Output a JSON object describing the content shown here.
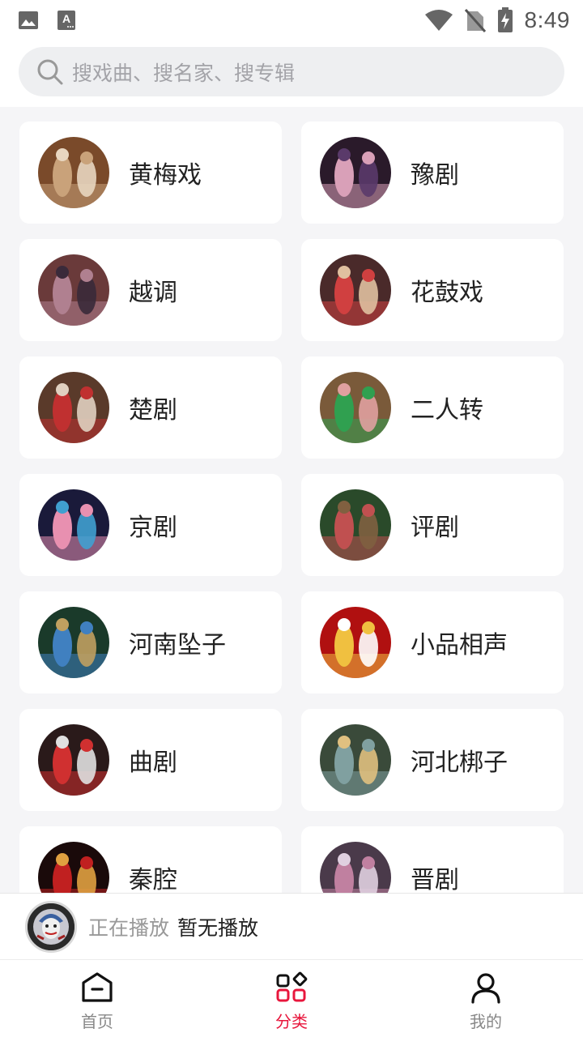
{
  "status_bar": {
    "left_icons": [
      "image-icon",
      "text-icon"
    ],
    "right_icons": [
      "wifi-icon",
      "no-sim-icon",
      "battery-charging-icon"
    ],
    "time": "8:49"
  },
  "search": {
    "placeholder": "搜戏曲、搜名家、搜专辑"
  },
  "categories": [
    {
      "label": "黄梅戏",
      "thumb_colors": [
        "#7a4a2a",
        "#c9a27a",
        "#e8d6c0"
      ]
    },
    {
      "label": "豫剧",
      "thumb_colors": [
        "#2a1a2a",
        "#d9a0b8",
        "#5a3a6a"
      ]
    },
    {
      "label": "越调",
      "thumb_colors": [
        "#6a3a3a",
        "#b08090",
        "#3a2a3a"
      ]
    },
    {
      "label": "花鼓戏",
      "thumb_colors": [
        "#4a2a2a",
        "#d04040",
        "#e0c0a0"
      ]
    },
    {
      "label": "楚剧",
      "thumb_colors": [
        "#5a3a2a",
        "#c03030",
        "#e0d0c0"
      ]
    },
    {
      "label": "二人转",
      "thumb_colors": [
        "#7a5a3a",
        "#30a050",
        "#e0a0a0"
      ]
    },
    {
      "label": "京剧",
      "thumb_colors": [
        "#1a1a3a",
        "#e890b0",
        "#40a0d0"
      ]
    },
    {
      "label": "评剧",
      "thumb_colors": [
        "#2a4a2a",
        "#c05050",
        "#806040"
      ]
    },
    {
      "label": "河南坠子",
      "thumb_colors": [
        "#1a3a2a",
        "#4080c0",
        "#c0a060"
      ]
    },
    {
      "label": "小品相声",
      "thumb_colors": [
        "#b01010",
        "#f0c040",
        "#ffffff"
      ]
    },
    {
      "label": "曲剧",
      "thumb_colors": [
        "#2a1a1a",
        "#d03030",
        "#e0e0e0"
      ]
    },
    {
      "label": "河北梆子",
      "thumb_colors": [
        "#3a4a3a",
        "#80a0a0",
        "#e0c080"
      ]
    },
    {
      "label": "秦腔",
      "thumb_colors": [
        "#1a0a0a",
        "#c02020",
        "#e0a040"
      ]
    },
    {
      "label": "晋剧",
      "thumb_colors": [
        "#4a3a4a",
        "#c080a0",
        "#e0d0e0"
      ]
    }
  ],
  "now_playing": {
    "prefix": "正在播放",
    "title": "暂无播放"
  },
  "bottom_nav": {
    "items": [
      {
        "label": "首页",
        "icon": "home-icon",
        "active": false
      },
      {
        "label": "分类",
        "icon": "category-icon",
        "active": true
      },
      {
        "label": "我的",
        "icon": "profile-icon",
        "active": false
      }
    ]
  },
  "colors": {
    "accent": "#e8163c",
    "background": "#f5f5f7",
    "card": "#ffffff",
    "search_bg": "#eeeff1"
  }
}
